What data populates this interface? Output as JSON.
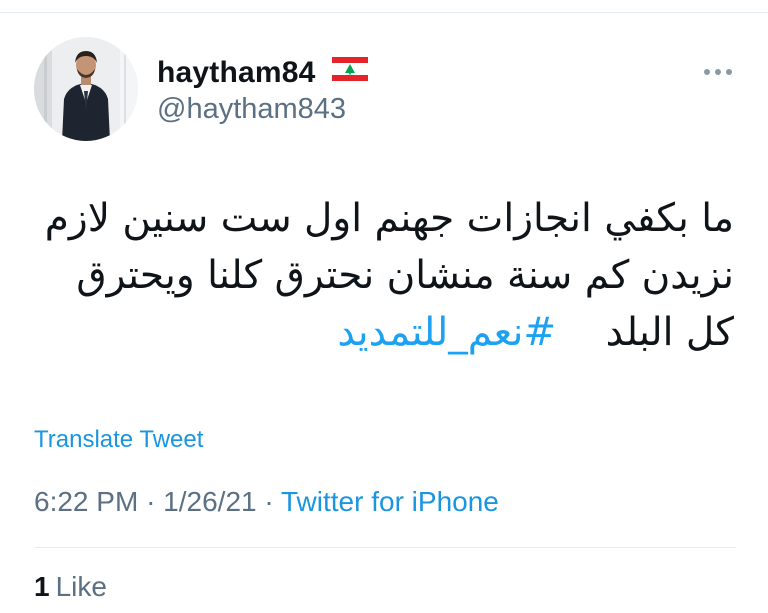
{
  "user": {
    "display_name": "haytham84",
    "handle": "@haytham843",
    "flag_icon": "lebanon-flag-icon"
  },
  "tweet": {
    "text": "ما بكفي انجازات جهنم اول ست سنين لازم نزيدن كم سنة منشان نحترق كلنا ويحترق كل البلد",
    "hashtag": "#نعم_للتمديد"
  },
  "translate_label": "Translate Tweet",
  "meta": {
    "time": "6:22 PM",
    "separator": "·",
    "date": "1/26/21",
    "source": "Twitter for iPhone"
  },
  "likes": {
    "count": "1",
    "label": "Like"
  },
  "colors": {
    "accent": "#1da1f2",
    "link": "#1b95e0",
    "secondary_text": "#5b7083",
    "divider": "#e6ecf0",
    "flag_red": "#e3242b",
    "flag_green": "#00a651"
  },
  "icons": {
    "more": "more-horizontal-icon"
  }
}
